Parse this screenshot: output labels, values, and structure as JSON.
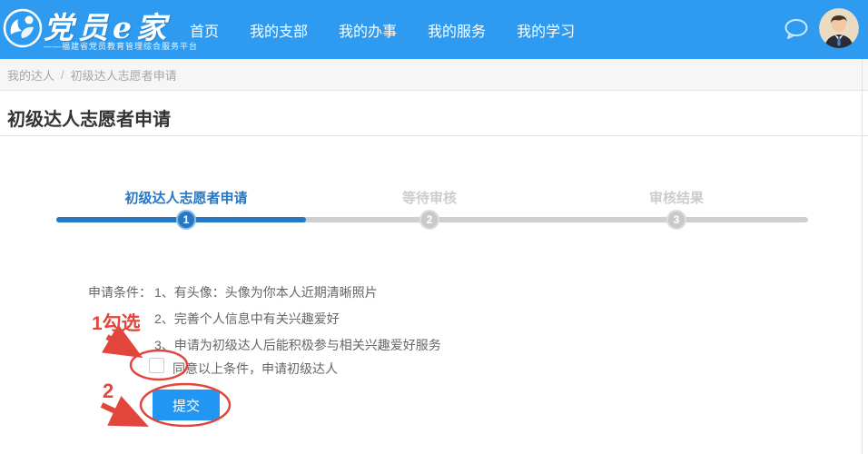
{
  "header": {
    "logo": {
      "title": "党员e家",
      "subtitle": "——福建省党员教育管理综合服务平台"
    },
    "nav": [
      {
        "label": "首页"
      },
      {
        "label": "我的支部"
      },
      {
        "label": "我的办事"
      },
      {
        "label": "我的服务"
      },
      {
        "label": "我的学习"
      }
    ],
    "icons": {
      "chat": "speech-bubble-outline",
      "avatar": "user-portrait"
    },
    "colors": {
      "header_bg": "#2e9bf0"
    }
  },
  "breadcrumb": {
    "items": [
      "我的达人",
      "初级达人志愿者申请"
    ],
    "separator": "/"
  },
  "page": {
    "title": "初级达人志愿者申请"
  },
  "steps": {
    "items": [
      {
        "number": "1",
        "label": "初级达人志愿者申请",
        "state": "active"
      },
      {
        "number": "2",
        "label": "等待审核",
        "state": "pending"
      },
      {
        "number": "3",
        "label": "审核结果",
        "state": "pending"
      }
    ],
    "colors": {
      "active": "#2778c4",
      "pending": "#c9c9c9"
    }
  },
  "conditions": {
    "label": "申请条件：",
    "items": [
      "1、有头像：头像为你本人近期清晰照片",
      "2、完善个人信息中有关兴趣爱好",
      "3、申请为初级达人后能积极参与相关兴趣爱好服务"
    ]
  },
  "agreement": {
    "checked": false,
    "label": "同意以上条件，申请初级达人"
  },
  "submit": {
    "label": "提交"
  },
  "annotations": {
    "callout1": "1勾选",
    "callout2": "2",
    "color": "#e2453c"
  }
}
